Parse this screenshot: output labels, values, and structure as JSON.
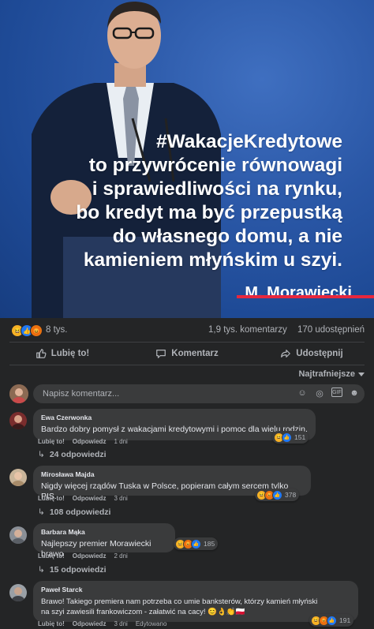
{
  "post": {
    "quote_lines": [
      "#WakacjeKredytowe",
      "to przywrócenie równowagi",
      "i sprawiedliwości na rynku,",
      "bo kredyt ma być przepustką",
      "do własnego domu, a nie",
      "kamieniem młyńskim u szyi."
    ],
    "author": "M. Morawiecki",
    "reactions_count": "8 tys.",
    "comments_count": "1,9 tys. komentarzy",
    "shares_count": "170 udostępnień"
  },
  "actions": {
    "like": "Lubię to!",
    "comment": "Komentarz",
    "share": "Udostępnij"
  },
  "sort_label": "Najtrafniejsze",
  "composer": {
    "placeholder": "Napisz komentarz..."
  },
  "comments": [
    {
      "name": "Ewa Czerwonka",
      "text": "Bardzo dobry pomysł z wakacjami kredytowymi i pomoc dla wielu rodzin.",
      "reaction_count": "151",
      "like": "Lubię to!",
      "reply": "Odpowiedz",
      "time": "1 dni",
      "replies": "24 odpowiedzi"
    },
    {
      "name": "Mirosława Majda",
      "text": "Nigdy więcej rządów Tuska w Polsce, popieram całym sercem tylko PIS.",
      "reaction_count": "378",
      "like": "Lubię to!",
      "reply": "Odpowiedz",
      "time": "3 dni",
      "replies": "108 odpowiedzi"
    },
    {
      "name": "Barbara Mąka",
      "text": "Najlepszy premier Morawiecki brawo",
      "reaction_count": "185",
      "like": "Lubię to!",
      "reply": "Odpowiedz",
      "time": "2 dni",
      "replies": "15 odpowiedzi"
    },
    {
      "name": "Paweł Starck",
      "text_line1": "Brawo! Takiego premiera nam potrzeba co umie banksterów, którzy kamień młyński",
      "text_line2": "na szyi zawiesili frankowiczom - załatwić na cacy! 😊👌👏🇵🇱",
      "reaction_count": "191",
      "like": "Lubię to!",
      "reply": "Odpowiedz",
      "time": "3 dni",
      "edited": "Edytowano"
    }
  ],
  "colors": {
    "background": "#242526",
    "bubble": "#3a3b3c",
    "photo_blue": "#2a57a6",
    "accent_red": "#e8273d",
    "like_blue": "#2078f4"
  }
}
